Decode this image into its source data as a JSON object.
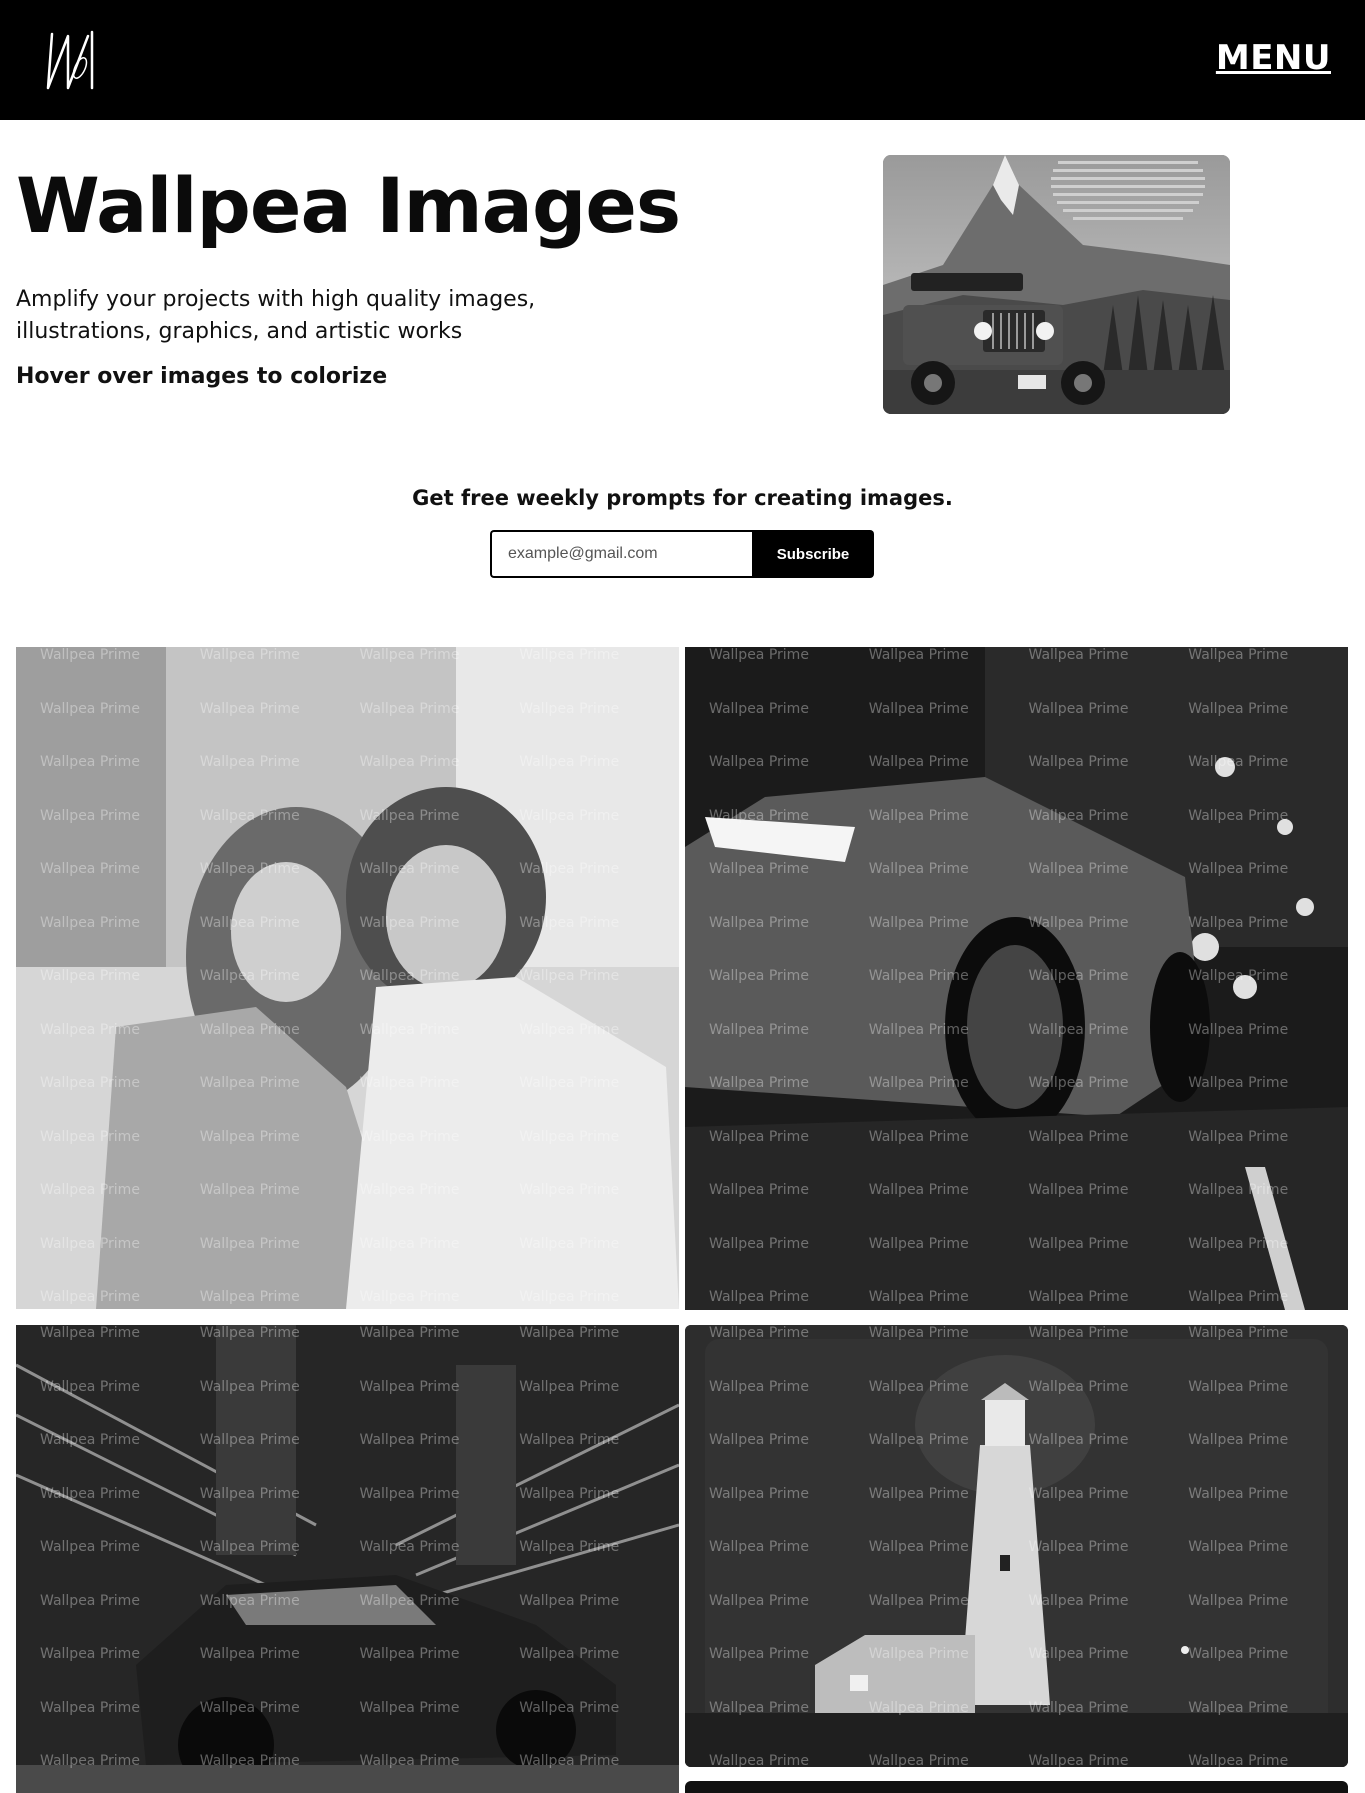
{
  "header": {
    "logo_icon": "wallpea-w-logo-icon",
    "menu_label": "MENU"
  },
  "hero": {
    "title": "Wallpea Images",
    "subtitle": "Amplify your projects with high quality images, illustrations, graphics, and artistic works",
    "hint": "Hover over images to colorize",
    "featured_image_icon": "jeep-mountain-image"
  },
  "subscribe": {
    "heading": "Get free weekly prompts for creating images.",
    "email_placeholder": "example@gmail.com",
    "button_label": "Subscribe"
  },
  "gallery": {
    "watermark": "Wallpea Prime",
    "tiles": [
      {
        "subject": "couple-portrait-image"
      },
      {
        "subject": "sports-car-night-street-image"
      },
      {
        "subject": "speeding-car-city-image"
      },
      {
        "subject": "lighthouse-night-image"
      },
      {
        "subject": "dark-image"
      }
    ]
  }
}
